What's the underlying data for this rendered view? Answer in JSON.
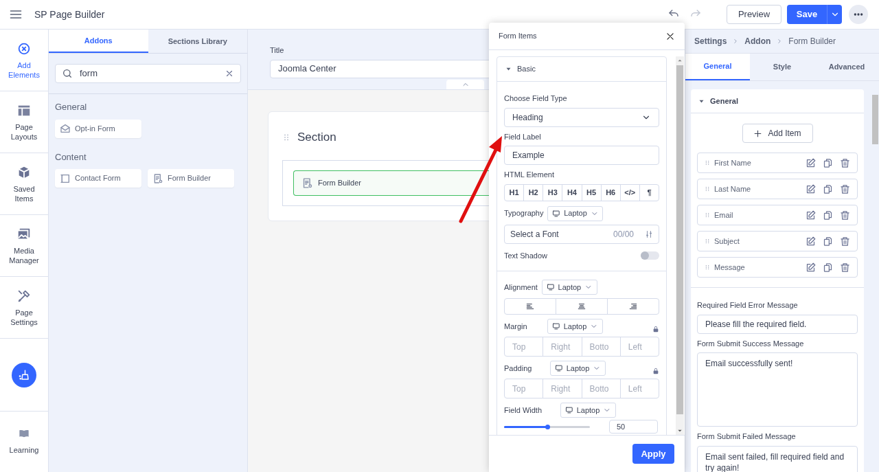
{
  "app": {
    "title": "SP Page Builder"
  },
  "toolbar": {
    "preview": "Preview",
    "save": "Save"
  },
  "rail": {
    "items": [
      {
        "label": "Add Elements",
        "selected": true
      },
      {
        "label": "Page Layouts",
        "selected": false
      },
      {
        "label": "Saved Items",
        "selected": false
      },
      {
        "label": "Media Manager",
        "selected": false
      },
      {
        "label": "Page Settings",
        "selected": false
      }
    ],
    "learning": "Learning"
  },
  "addons_panel": {
    "tabs": [
      {
        "label": "Addons",
        "selected": true
      },
      {
        "label": "Sections Library",
        "selected": false
      }
    ],
    "search": {
      "value": "form"
    },
    "groups": [
      {
        "title": "General",
        "items": [
          "Opt-in Form"
        ]
      },
      {
        "title": "Content",
        "items": [
          "Contact Form",
          "Form Builder"
        ]
      }
    ]
  },
  "canvas": {
    "title_label": "Title",
    "title_value": "Joomla Center",
    "section": {
      "title": "Section",
      "addon": "Form Builder"
    }
  },
  "form_items_dialog": {
    "title": "Form Items",
    "group": {
      "title": "Basic",
      "expanded": true
    },
    "field_type": {
      "label": "Choose Field Type",
      "value": "Heading"
    },
    "field_label": {
      "label": "Field Label",
      "value": "Example"
    },
    "html_element": {
      "label": "HTML Element",
      "options": [
        "H1",
        "H2",
        "H3",
        "H4",
        "H5",
        "H6",
        "</>",
        "¶"
      ]
    },
    "typography": {
      "label": "Typography",
      "device": "Laptop",
      "font": "Select a Font",
      "size": "00/00"
    },
    "text_shadow": {
      "label": "Text Shadow",
      "on": false
    },
    "alignment": {
      "label": "Alignment",
      "device": "Laptop"
    },
    "margin": {
      "label": "Margin",
      "device": "Laptop",
      "placeholders": [
        "Top",
        "Right",
        "Botto",
        "Left"
      ]
    },
    "padding": {
      "label": "Padding",
      "device": "Laptop",
      "placeholders": [
        "Top",
        "Right",
        "Botto",
        "Left"
      ]
    },
    "field_width": {
      "label": "Field Width",
      "device": "Laptop",
      "level": 0.5,
      "value": "50"
    },
    "apply": "Apply"
  },
  "settings_panel": {
    "breadcrumb": [
      "Settings",
      "Addon",
      "Form Builder"
    ],
    "tabs": [
      {
        "label": "General",
        "selected": true
      },
      {
        "label": "Style",
        "selected": false
      },
      {
        "label": "Advanced",
        "selected": false
      }
    ],
    "group": {
      "title": "General",
      "expanded": true
    },
    "add_item": "Add Item",
    "items": [
      "First Name",
      "Last Name",
      "Email",
      "Subject",
      "Message"
    ],
    "fields": [
      {
        "kind": "input",
        "label": "Required Field Error Message",
        "value": "Please fill the required field."
      },
      {
        "kind": "textarea",
        "label": "Form Submit Success Message",
        "value": "Email successfully sent!"
      },
      {
        "kind": "textarea",
        "label": "Form Submit Failed Message",
        "value": "Email sent failed, fill required field and try again!"
      }
    ]
  }
}
